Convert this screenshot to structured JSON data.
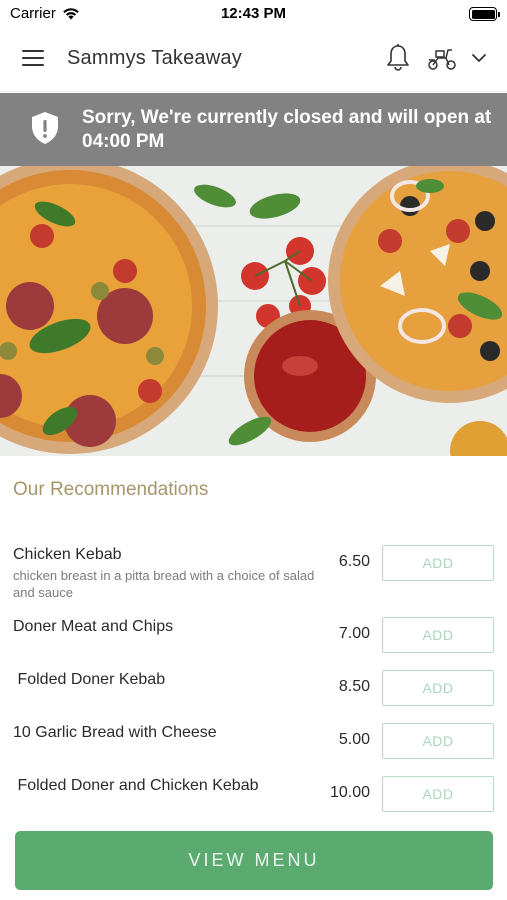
{
  "status_bar": {
    "carrier": "Carrier",
    "time": "12:43 PM"
  },
  "header": {
    "title": "Sammys Takeaway",
    "icons": [
      "menu-icon",
      "bell-icon",
      "scooter-icon",
      "chevron-down-icon"
    ]
  },
  "banner": {
    "message": "Sorry, We're currently closed and will open at 04:00 PM",
    "icon": "shield-alert-icon"
  },
  "recommendations": {
    "title": "Our Recommendations",
    "add_label": "ADD",
    "items": [
      {
        "name": "Chicken Kebab",
        "description": "chicken breast in a pitta bread with a choice of salad and sauce",
        "price": "6.50"
      },
      {
        "name": "Doner Meat and Chips",
        "description": "",
        "price": "7.00"
      },
      {
        "name": " Folded Doner Kebab",
        "description": "",
        "price": "8.50"
      },
      {
        "name": "10 Garlic Bread with Cheese",
        "description": "",
        "price": "5.00"
      },
      {
        "name": " Folded Doner and Chicken Kebab",
        "description": "",
        "price": "10.00"
      }
    ]
  },
  "footer": {
    "view_menu_label": "VIEW MENU"
  },
  "colors": {
    "accent_green": "#5baa70",
    "banner_gray": "#828282",
    "section_title": "#a7956c",
    "add_border": "#b6dcc4"
  }
}
